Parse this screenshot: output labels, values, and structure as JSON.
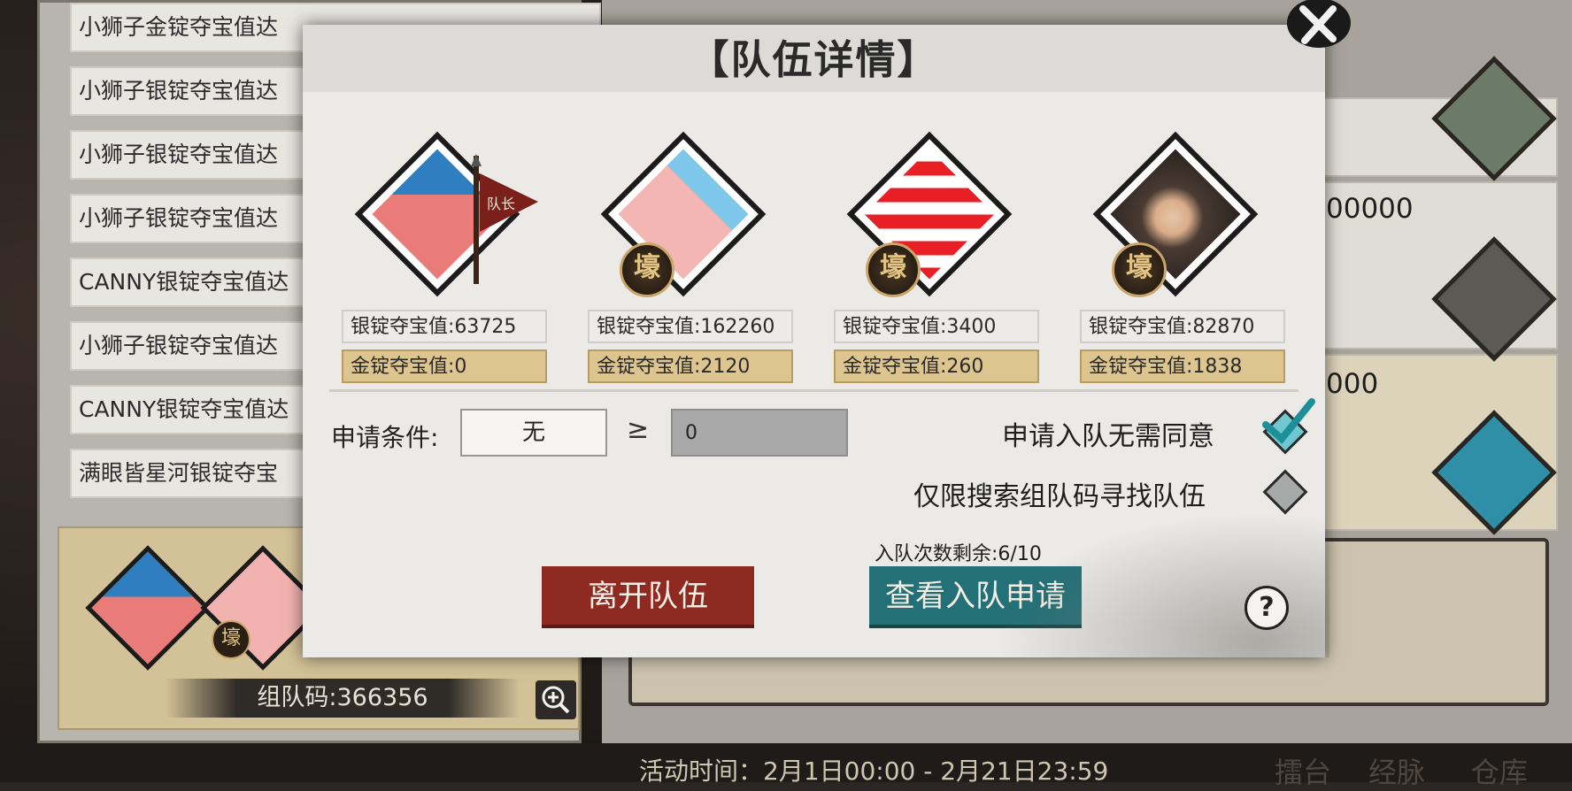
{
  "log": {
    "items": [
      "小狮子金锭夺宝值达",
      "小狮子银锭夺宝值达",
      "小狮子银锭夺宝值达",
      "小狮子银锭夺宝值达",
      "CANNY银锭夺宝值达",
      "小狮子银锭夺宝值达",
      "CANNY银锭夺宝值达",
      "满眼皆星河银锭夺宝"
    ]
  },
  "left_team": {
    "team_code": "组队码:366356"
  },
  "right_bg": {
    "value_1": "00000",
    "value_2": "000"
  },
  "footer": {
    "activity_time": "活动时间：2月1日00:00 - 2月21日23:59",
    "tabs": [
      "擂台",
      "经脉",
      "仓库"
    ]
  },
  "modal": {
    "title": "【队伍详情】",
    "members": [
      {
        "silver": "银锭夺宝值:63725",
        "gold": "金锭夺宝值:0",
        "has_badge": false
      },
      {
        "silver": "银锭夺宝值:162260",
        "gold": "金锭夺宝值:2120",
        "has_badge": true
      },
      {
        "silver": "银锭夺宝值:3400",
        "gold": "金锭夺宝值:260",
        "has_badge": true
      },
      {
        "silver": "银锭夺宝值:82870",
        "gold": "金锭夺宝值:1838",
        "has_badge": true
      }
    ],
    "badge_char": "壕",
    "leader_flag": "队长",
    "condition_label": "申请条件:",
    "condition_value": "无",
    "condition_operator": "≥",
    "condition_threshold": "0",
    "option_auto_accept": {
      "label": "申请入队无需同意",
      "checked": true
    },
    "option_search_only": {
      "label": "仅限搜索组队码寻找队伍",
      "checked": false
    },
    "remaining": "入队次数剩余:6/10",
    "leave_button": "离开队伍",
    "view_button": "查看入队申请",
    "help": "?"
  },
  "colors": {
    "accent_red": "#8f2a23",
    "accent_teal": "#237077",
    "gold_stat": "#ddc590",
    "check_teal": "#2aa4b0"
  }
}
